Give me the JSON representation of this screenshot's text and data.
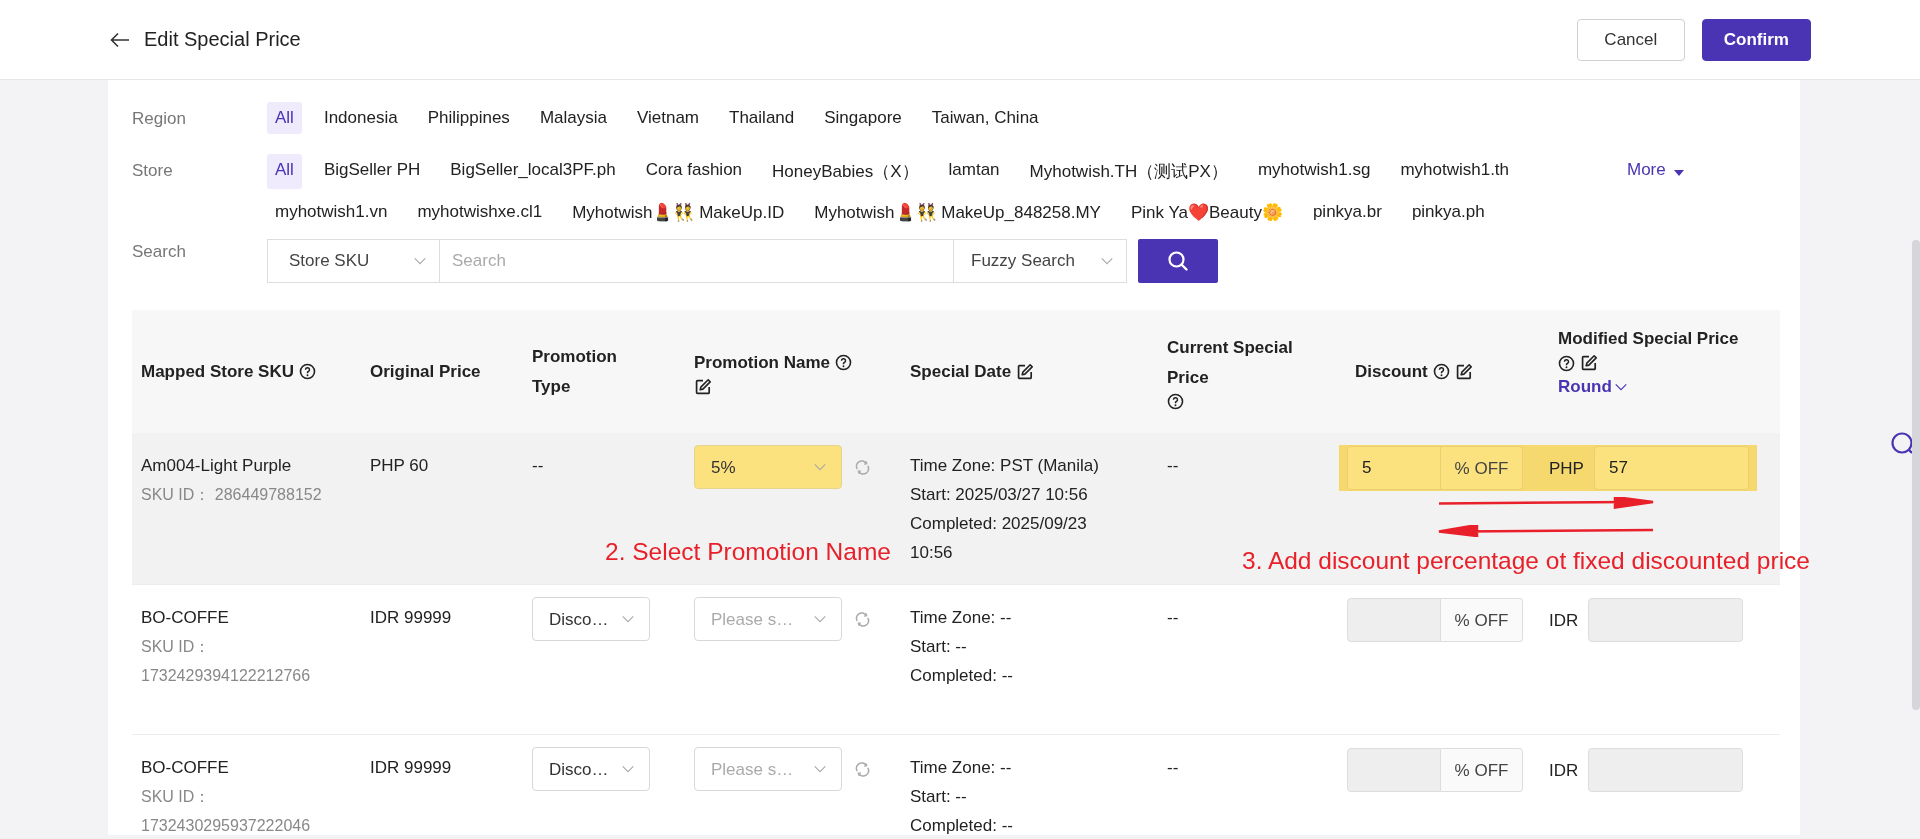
{
  "header": {
    "title": "Edit Special Price",
    "buttons": [
      {
        "label": "Cancel",
        "kind": "secondary"
      },
      {
        "label": "Confirm",
        "kind": "primary"
      }
    ]
  },
  "filters": {
    "region": {
      "label": "Region",
      "options": [
        {
          "label": "All",
          "selected": true
        },
        {
          "label": "Indonesia",
          "selected": false
        },
        {
          "label": "Philippines",
          "selected": false
        },
        {
          "label": "Malaysia",
          "selected": false
        },
        {
          "label": "Vietnam",
          "selected": false
        },
        {
          "label": "Thailand",
          "selected": false
        },
        {
          "label": "Singapore",
          "selected": false
        },
        {
          "label": "Taiwan, China",
          "selected": false
        }
      ]
    },
    "store": {
      "label": "Store",
      "more": "More",
      "options": [
        {
          "label": "All",
          "selected": true
        },
        {
          "label": "BigSeller PH",
          "selected": false
        },
        {
          "label": "BigSeller_local3PF.ph",
          "selected": false
        },
        {
          "label": "Cora fashion",
          "selected": false
        },
        {
          "label": "HoneyBabies（X）",
          "selected": false
        },
        {
          "label": "lamtan",
          "selected": false
        },
        {
          "label": "Myhotwish.TH（测试PX）",
          "selected": false
        },
        {
          "label": "myhotwish1.sg",
          "selected": false
        },
        {
          "label": "myhotwish1.th",
          "selected": false
        },
        {
          "label": "myhotwish1.vn",
          "selected": false
        },
        {
          "label": "myhotwishxe.cl1",
          "selected": false
        },
        {
          "label": "Myhotwish💄👯 MakeUp.ID",
          "selected": false
        },
        {
          "label": "Myhotwish💄👯 MakeUp_848258.MY",
          "selected": false
        },
        {
          "label": "Pink Ya❤️Beauty🌼",
          "selected": false
        },
        {
          "label": "pinkya.br",
          "selected": false
        },
        {
          "label": "pinkya.ph",
          "selected": false
        }
      ]
    },
    "search": {
      "label": "Search",
      "field_type": "Store SKU",
      "placeholder": "Search",
      "mode": "Fuzzy Search"
    }
  },
  "table": {
    "columns": [
      {
        "label": "Mapped Store SKU",
        "help": true,
        "edit": false
      },
      {
        "label": "Original Price",
        "help": false,
        "edit": false
      },
      {
        "label": "Promotion Type",
        "help": false,
        "edit": false
      },
      {
        "label": "Promotion Name",
        "help": true,
        "edit": true
      },
      {
        "label": "Special Date",
        "help": false,
        "edit": true
      },
      {
        "label": "Current Special Price",
        "help": true,
        "edit": false
      },
      {
        "label": "Discount",
        "help": true,
        "edit": true
      },
      {
        "label": "Modified Special Price",
        "help": true,
        "edit": true,
        "link": "Round"
      }
    ],
    "rows": [
      {
        "highlighted": true,
        "sku": "Am004-Light Purple",
        "sku_id": "SKU ID：  286449788152",
        "original_price": "PHP 60",
        "promotion_type": {
          "kind": "text",
          "text": "--"
        },
        "promotion_name": {
          "value": "5%"
        },
        "time_zone": "Time Zone: PST (Manila)",
        "start": "Start: 2025/03/27 10:56",
        "completed": "Completed: 2025/09/23 10:56",
        "current_special_price": "--",
        "discount": {
          "value": "5",
          "unit": "% OFF",
          "disabled": false
        },
        "modified_price": {
          "currency": "PHP",
          "value": "57",
          "disabled": false
        }
      },
      {
        "highlighted": false,
        "sku": "BO-COFFE",
        "sku_id": "SKU ID： 1732429394122212766",
        "original_price": "IDR 99999",
        "promotion_type": {
          "kind": "select",
          "text": "Disco…"
        },
        "promotion_name": {
          "placeholder": "Please s…"
        },
        "time_zone": "Time Zone: --",
        "start": "Start: --",
        "completed": "Completed: --",
        "current_special_price": "--",
        "discount": {
          "unit": "% OFF",
          "disabled": true
        },
        "modified_price": {
          "currency": "IDR",
          "disabled": true
        }
      },
      {
        "highlighted": false,
        "sku": "BO-COFFE",
        "sku_id": "SKU ID： 1732430295937222046",
        "original_price": "IDR 99999",
        "promotion_type": {
          "kind": "select",
          "text": "Disco…"
        },
        "promotion_name": {
          "placeholder": "Please s…"
        },
        "time_zone": "Time Zone: --",
        "start": "Start: --",
        "completed": "Completed: --",
        "current_special_price": "--",
        "discount": {
          "unit": "% OFF",
          "disabled": true
        },
        "modified_price": {
          "currency": "IDR",
          "disabled": true
        }
      }
    ]
  },
  "annotations": [
    {
      "text": "2. Select Promotion Name"
    },
    {
      "text": "3. Add discount percentage ot fixed discounted price"
    }
  ]
}
